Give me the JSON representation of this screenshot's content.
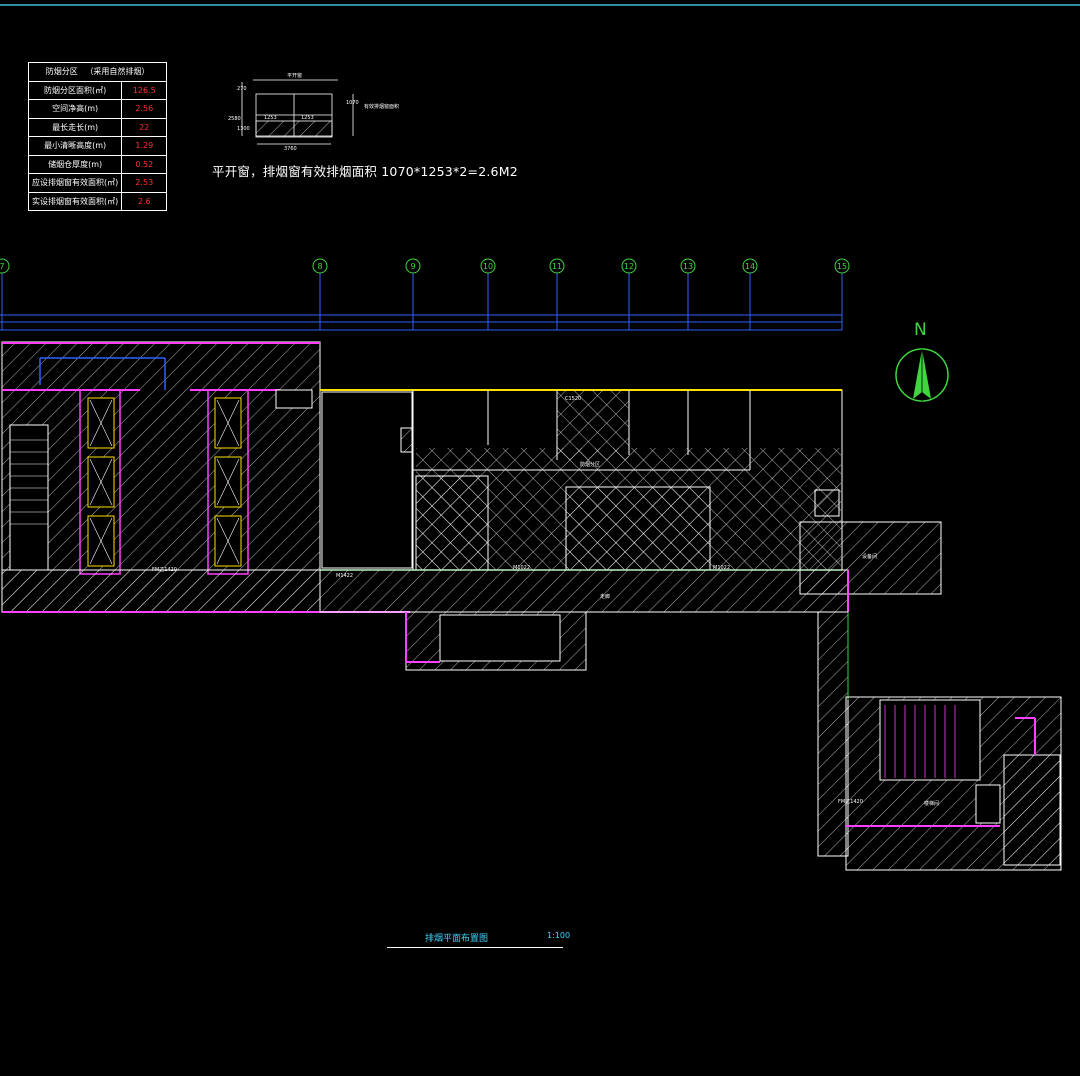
{
  "table": {
    "header_left": "防烟分区",
    "header_right": "（采用自然排烟）",
    "rows": [
      {
        "label": "防烟分区面积(㎡)",
        "value": "126.5"
      },
      {
        "label": "空间净高(m)",
        "value": "2.56"
      },
      {
        "label": "最长走长(m)",
        "value": "22"
      },
      {
        "label": "最小清晰高度(m)",
        "value": "1.29"
      },
      {
        "label": "储烟仓厚度(m)",
        "value": "0.52"
      },
      {
        "label": "应设排烟窗有效面积(㎡)",
        "value": "2.53"
      },
      {
        "label": "实设排烟窗有效面积(㎡)",
        "value": "2.6"
      }
    ]
  },
  "window_detail": {
    "top_label": "平开窗",
    "side_label": "有效排烟窗面积",
    "dims": {
      "d1": "270",
      "d2": "2580",
      "d3": "1300",
      "d4": "1070",
      "d5": "1253",
      "d6": "1253",
      "width": "3760"
    }
  },
  "formula": "平开窗，排烟窗有效排烟面积 1070*1253*2=2.6M2",
  "axes": [
    "7",
    "8",
    "9",
    "10",
    "11",
    "12",
    "13",
    "14",
    "15"
  ],
  "north": "N",
  "room_labels": {
    "smoke_zone": "防烟分区",
    "corridor": "走廊",
    "stair": "楼梯间",
    "door_left": "FM乙1420",
    "door_right": "FM乙1420",
    "door_m1": "M1422",
    "door_m2": "M1022",
    "door_m3": "M1022",
    "window_mark": "C1520",
    "equip": "设备间"
  },
  "colors": {
    "accent_green": "#3fd63f",
    "magenta": "#ff40ff",
    "yellow": "#ffe000",
    "blue": "#3060ff",
    "cyan": "#3fd6ff"
  },
  "title": {
    "name": "排烟平面布置图",
    "scale": "1:100"
  }
}
